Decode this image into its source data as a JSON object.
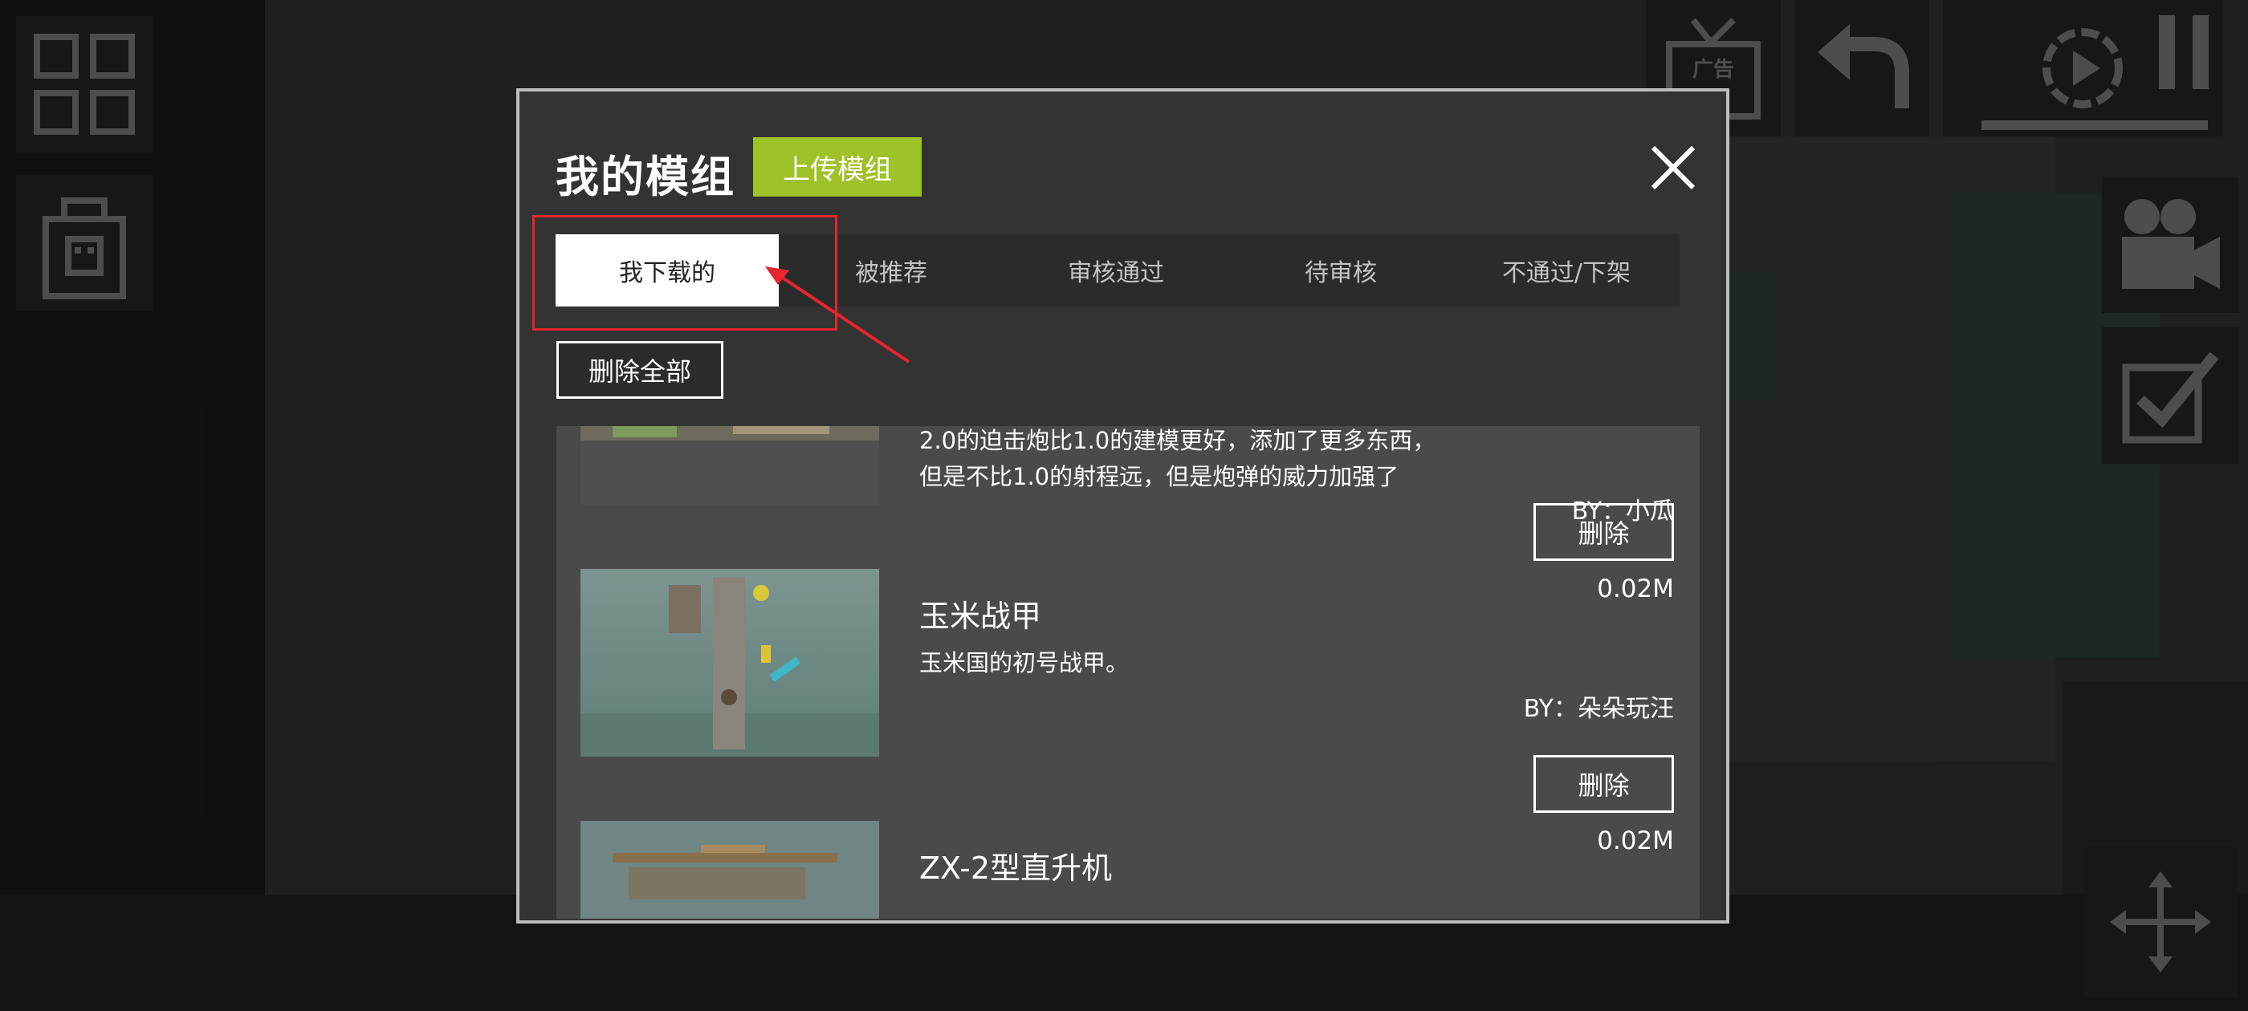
{
  "modal": {
    "title": "我的模组",
    "upload_label": "上传模组",
    "tabs": [
      {
        "label": "我下载的",
        "active": true
      },
      {
        "label": "被推荐",
        "active": false
      },
      {
        "label": "审核通过",
        "active": false
      },
      {
        "label": "待审核",
        "active": false
      },
      {
        "label": "不通过/下架",
        "active": false
      }
    ],
    "delete_all_label": "删除全部",
    "mods": [
      {
        "desc": [
          "2.0的迫击炮比1.0的建模更好，添加了更多东西，",
          "但是不比1.0的射程远，但是炮弹的威力加强了"
        ],
        "author": "BY：小瓜"
      },
      {
        "name": "玉米战甲",
        "desc": [
          "玉米国的初号战甲。"
        ],
        "author": "BY：朵朵玩汪",
        "size": "0.02M",
        "delete_label": "删除"
      },
      {
        "name": "ZX-2型直升机",
        "size": "0.02M",
        "delete_label": "删除"
      }
    ]
  },
  "hud": {
    "left": [
      "grid-menu-icon",
      "lock-icon"
    ],
    "right": [
      "ad-tv-icon",
      "undo-icon",
      "slow-motion-icon",
      "pause-icon",
      "camera-icon",
      "checkbox-icon",
      "move-icon"
    ]
  },
  "colors": {
    "accent_green": "#9fc229",
    "highlight_red": "#e8252b",
    "panel": "#333333",
    "list_bg": "#4a4a4a"
  }
}
